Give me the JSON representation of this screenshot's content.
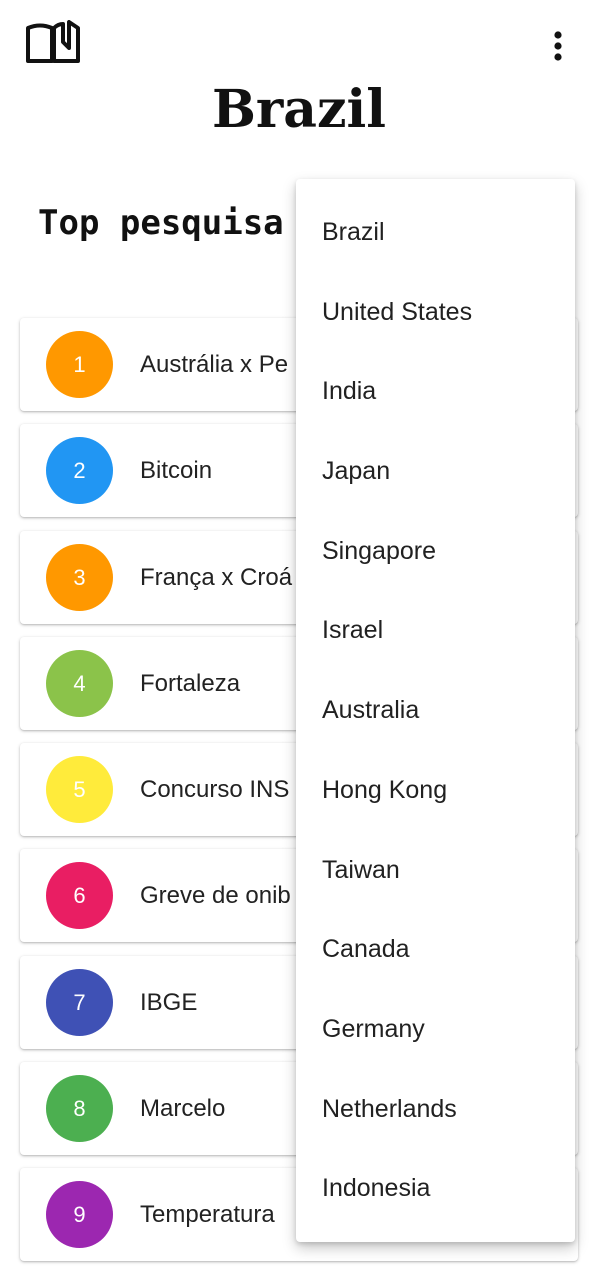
{
  "header": {
    "title": "Brazil",
    "left_icon": "book-open-icon",
    "right_icon": "more-vert-icon"
  },
  "section": {
    "title": "Top pesquisa"
  },
  "trends": [
    {
      "rank": "1",
      "term": "Austrália x Pe",
      "color": "#FF9800"
    },
    {
      "rank": "2",
      "term": "Bitcoin",
      "color": "#2196F3"
    },
    {
      "rank": "3",
      "term": "França x Croá",
      "color": "#FF9800"
    },
    {
      "rank": "4",
      "term": "Fortaleza",
      "color": "#8BC34A"
    },
    {
      "rank": "5",
      "term": "Concurso INS",
      "color": "#FFEB3B"
    },
    {
      "rank": "6",
      "term": "Greve de onib",
      "color": "#E91E63"
    },
    {
      "rank": "7",
      "term": "IBGE",
      "color": "#3F51B5"
    },
    {
      "rank": "8",
      "term": "Marcelo",
      "color": "#4CAF50"
    },
    {
      "rank": "9",
      "term": "Temperatura",
      "color": "#9C27B0"
    }
  ],
  "country_menu": {
    "items": [
      "Brazil",
      "United States",
      "India",
      "Japan",
      "Singapore",
      "Israel",
      "Australia",
      "Hong Kong",
      "Taiwan",
      "Canada",
      "Germany",
      "Netherlands",
      "Indonesia"
    ]
  }
}
